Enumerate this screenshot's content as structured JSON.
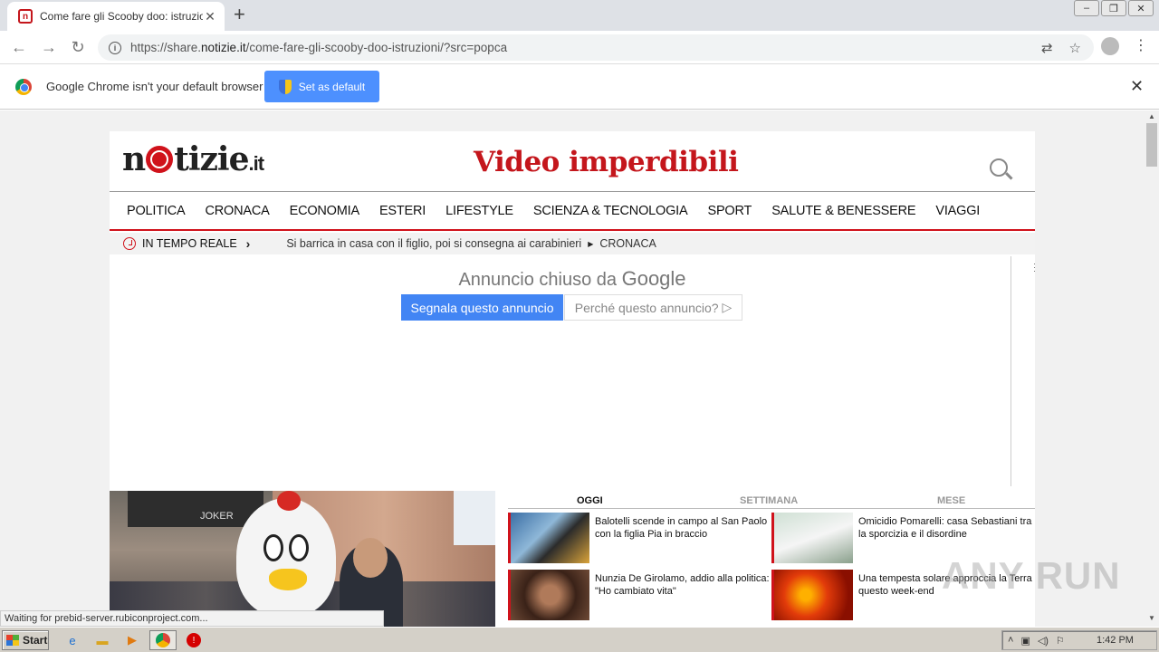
{
  "browser": {
    "tab_title": "Come fare gli Scooby doo: istruzioni e",
    "url_prefix": "https://share.",
    "url_domain": "notizie.it",
    "url_path": "/come-fare-gli-scooby-doo-istruzioni/?src=popca",
    "infobar_text": "Google Chrome isn't your default browser",
    "set_default_label": "Set as default",
    "status_text": "Waiting for prebid-server.rubiconproject.com..."
  },
  "site": {
    "logo_n": "n",
    "logo_rest": "tizie",
    "logo_tld": ".it",
    "headline": "Video imperdibili",
    "nav": [
      "POLITICA",
      "CRONACA",
      "ECONOMIA",
      "ESTERI",
      "LIFESTYLE",
      "SCIENZA & TECNOLOGIA",
      "SPORT",
      "SALUTE & BENESSERE",
      "VIAGGI"
    ],
    "ticker_label": "IN TEMPO REALE",
    "ticker_news": "Si barrica in casa con il figlio, poi si consegna ai carabinieri",
    "ticker_category": "CRONACA"
  },
  "ad": {
    "closed_prefix": "Annuncio chiuso da",
    "closed_brand": "Google",
    "report_label": "Segnala questo annuncio",
    "why_label": "Perché questo annuncio?"
  },
  "video": {
    "shop_sign": "JOKER"
  },
  "popular": {
    "tabs": [
      "OGGI",
      "SETTIMANA",
      "MESE"
    ],
    "items": [
      "Balotelli scende in campo al San Paolo con la figlia Pia in braccio",
      "Omicidio Pomarelli: casa Sebastiani tra la sporcizia e il disordine",
      "Nunzia De Girolamo, addio alla politica: \"Ho cambiato vita\"",
      "Una tempesta solare approccia la Terra questo week-end"
    ]
  },
  "watermark": "ANY RUN",
  "taskbar": {
    "start_label": "Start",
    "clock": "1:42 PM"
  }
}
